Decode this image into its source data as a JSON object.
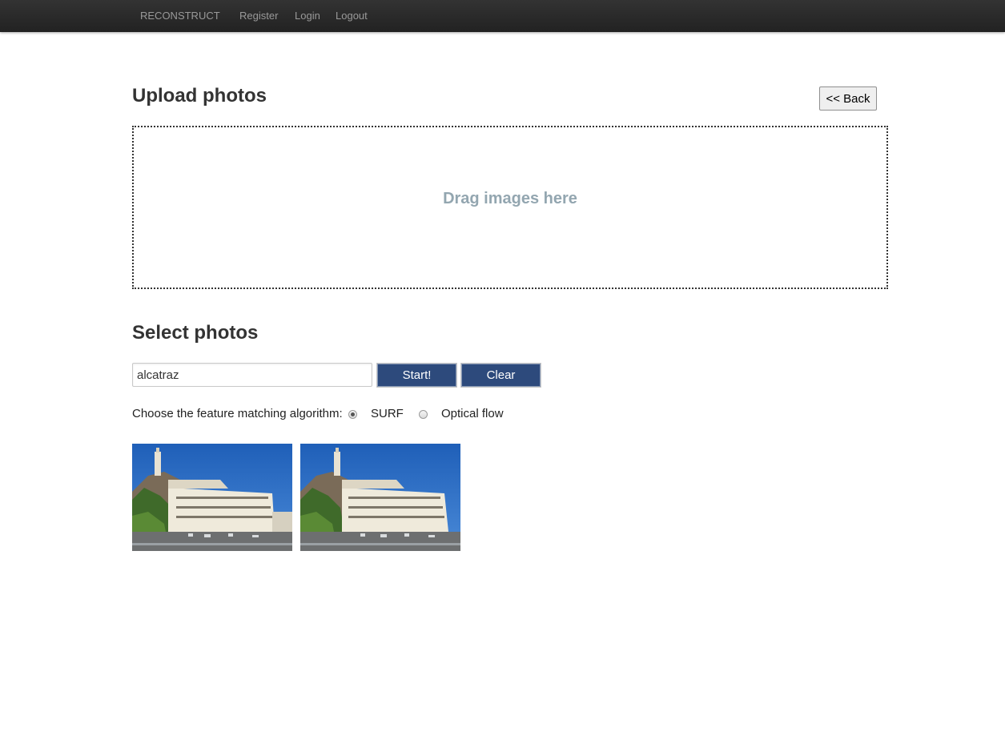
{
  "navbar": {
    "brand": "RECONSTRUCT",
    "items": [
      {
        "label": "Register"
      },
      {
        "label": "Login"
      },
      {
        "label": "Logout"
      }
    ]
  },
  "upload": {
    "title": "Upload photos",
    "back_label": "<< Back",
    "dropzone_text": "Drag images here"
  },
  "select": {
    "title": "Select photos",
    "search_value": "alcatraz",
    "start_label": "Start!",
    "clear_label": "Clear"
  },
  "algorithm": {
    "label": "Choose the feature matching algorithm:",
    "options": [
      {
        "label": "SURF",
        "selected": true
      },
      {
        "label": "Optical flow",
        "selected": false
      }
    ]
  },
  "thumbnails": [
    {
      "name": "alcatraz-photo-1"
    },
    {
      "name": "alcatraz-photo-2"
    }
  ],
  "colors": {
    "button_blue": "#2d4a7c",
    "dropzone_text": "#93a6b0",
    "navbar": "#2a2a2a"
  }
}
